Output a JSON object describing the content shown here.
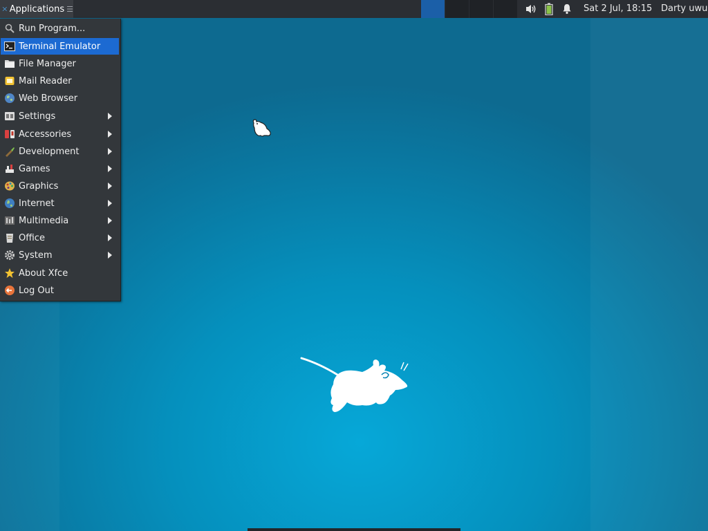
{
  "panel": {
    "applications_label": "Applications",
    "clock": "Sat  2 Jul, 18:15",
    "user": "Darty uwu",
    "tray_icons": [
      "volume-icon",
      "battery-icon",
      "notification-bell-icon"
    ],
    "workspaces_count": 4,
    "active_workspace": 1
  },
  "menu": {
    "items": [
      {
        "label": "Run Program...",
        "icon": "search-icon",
        "submenu": false
      },
      {
        "label": "Terminal Emulator",
        "icon": "terminal-icon",
        "submenu": false,
        "selected": true
      },
      {
        "label": "File Manager",
        "icon": "folder-icon",
        "submenu": false
      },
      {
        "label": "Mail Reader",
        "icon": "mail-icon",
        "submenu": false
      },
      {
        "label": "Web Browser",
        "icon": "globe-icon",
        "submenu": false
      },
      {
        "label": "Settings",
        "icon": "settings-icon",
        "submenu": true
      },
      {
        "label": "Accessories",
        "icon": "accessories-icon",
        "submenu": true
      },
      {
        "label": "Development",
        "icon": "development-icon",
        "submenu": true
      },
      {
        "label": "Games",
        "icon": "games-icon",
        "submenu": true
      },
      {
        "label": "Graphics",
        "icon": "palette-icon",
        "submenu": true
      },
      {
        "label": "Internet",
        "icon": "internet-globe-icon",
        "submenu": true
      },
      {
        "label": "Multimedia",
        "icon": "multimedia-icon",
        "submenu": true
      },
      {
        "label": "Office",
        "icon": "office-icon",
        "submenu": true
      },
      {
        "label": "System",
        "icon": "gear-icon",
        "submenu": true
      },
      {
        "label": "About Xfce",
        "icon": "star-icon",
        "submenu": false
      },
      {
        "label": "Log Out",
        "icon": "logout-icon",
        "submenu": false
      }
    ]
  },
  "colors": {
    "panel_bg": "#2b2e33",
    "menu_bg": "#33373b",
    "selection": "#1c6ad2",
    "desktop_accent": "#06a8d8"
  }
}
